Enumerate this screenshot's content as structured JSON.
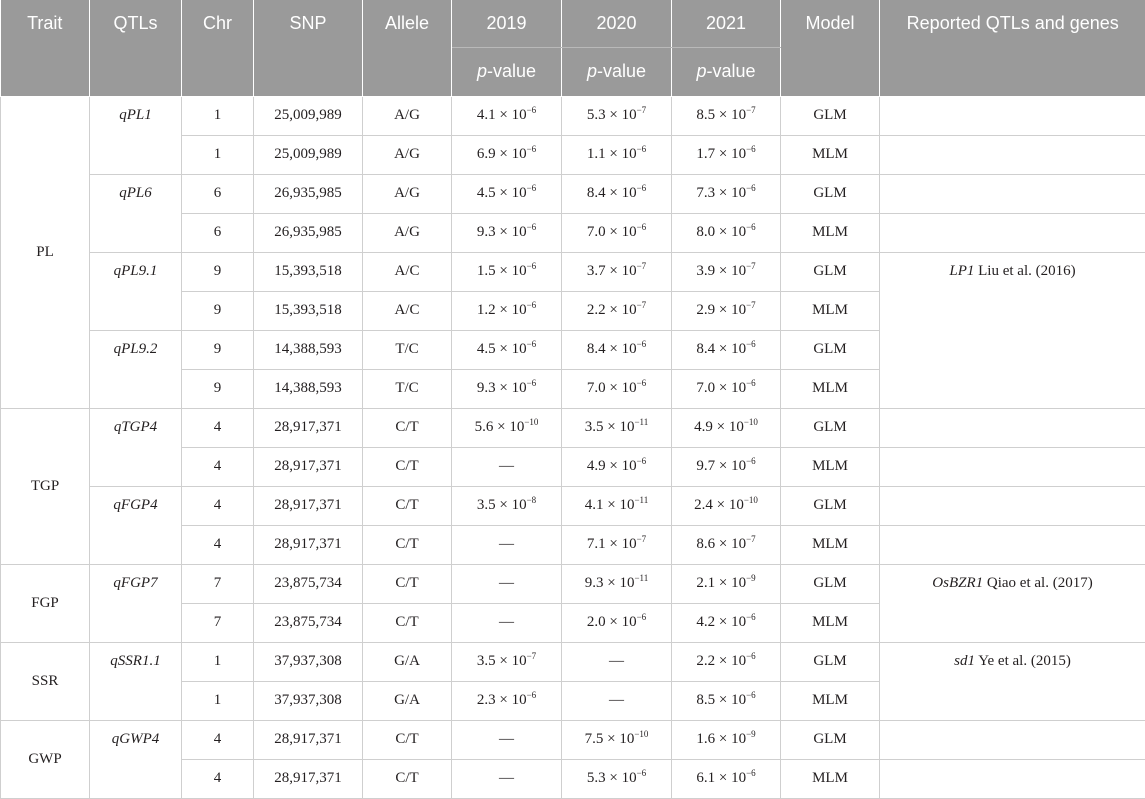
{
  "headers": {
    "trait": "Trait",
    "qtls": "QTLs",
    "chr": "Chr",
    "snp": "SNP",
    "allele": "Allele",
    "y2019": "2019",
    "y2020": "2020",
    "y2021": "2021",
    "model": "Model",
    "reported": "Reported QTLs and genes",
    "pvalue_italic": "p",
    "pvalue_rest": "-value"
  },
  "traits": {
    "pl": "PL",
    "tgp": "TGP",
    "fgp": "FGP",
    "ssr": "SSR",
    "gwp": "GWP"
  },
  "qtls": {
    "qpl1": "qPL1",
    "qpl6": "qPL6",
    "qpl91": "qPL9.1",
    "qpl92": "qPL9.2",
    "qtgp4": "qTGP4",
    "qfgp4": "qFGP4",
    "qfgp7": "qFGP7",
    "qssr11": "qSSR1.1",
    "qgwp4": "qGWP4"
  },
  "rows": [
    {
      "chr": "1",
      "snp": "25,009,989",
      "allele": "A/G",
      "p2019": {
        "m": "4.1",
        "e": "−6"
      },
      "p2020": {
        "m": "5.3",
        "e": "−7"
      },
      "p2021": {
        "m": "8.5",
        "e": "−7"
      },
      "model": "GLM"
    },
    {
      "chr": "1",
      "snp": "25,009,989",
      "allele": "A/G",
      "p2019": {
        "m": "6.9",
        "e": "−6"
      },
      "p2020": {
        "m": "1.1",
        "e": "−6"
      },
      "p2021": {
        "m": "1.7",
        "e": "−6"
      },
      "model": "MLM"
    },
    {
      "chr": "6",
      "snp": "26,935,985",
      "allele": "A/G",
      "p2019": {
        "m": "4.5",
        "e": "−6"
      },
      "p2020": {
        "m": "8.4",
        "e": "−6"
      },
      "p2021": {
        "m": "7.3",
        "e": "−6"
      },
      "model": "GLM"
    },
    {
      "chr": "6",
      "snp": "26,935,985",
      "allele": "A/G",
      "p2019": {
        "m": "9.3",
        "e": "−6"
      },
      "p2020": {
        "m": "7.0",
        "e": "−6"
      },
      "p2021": {
        "m": "8.0",
        "e": "−6"
      },
      "model": "MLM"
    },
    {
      "chr": "9",
      "snp": "15,393,518",
      "allele": "A/C",
      "p2019": {
        "m": "1.5",
        "e": "−6"
      },
      "p2020": {
        "m": "3.7",
        "e": "−7"
      },
      "p2021": {
        "m": "3.9",
        "e": "−7"
      },
      "model": "GLM"
    },
    {
      "chr": "9",
      "snp": "15,393,518",
      "allele": "A/C",
      "p2019": {
        "m": "1.2",
        "e": "−6"
      },
      "p2020": {
        "m": "2.2",
        "e": "−7"
      },
      "p2021": {
        "m": "2.9",
        "e": "−7"
      },
      "model": "MLM"
    },
    {
      "chr": "9",
      "snp": "14,388,593",
      "allele": "T/C",
      "p2019": {
        "m": "4.5",
        "e": "−6"
      },
      "p2020": {
        "m": "8.4",
        "e": "−6"
      },
      "p2021": {
        "m": "8.4",
        "e": "−6"
      },
      "model": "GLM"
    },
    {
      "chr": "9",
      "snp": "14,388,593",
      "allele": "T/C",
      "p2019": {
        "m": "9.3",
        "e": "−6"
      },
      "p2020": {
        "m": "7.0",
        "e": "−6"
      },
      "p2021": {
        "m": "7.0",
        "e": "−6"
      },
      "model": "MLM"
    },
    {
      "chr": "4",
      "snp": "28,917,371",
      "allele": "C/T",
      "p2019": {
        "m": "5.6",
        "e": "−10"
      },
      "p2020": {
        "m": "3.5",
        "e": "−11"
      },
      "p2021": {
        "m": "4.9",
        "e": "−10"
      },
      "model": "GLM"
    },
    {
      "chr": "4",
      "snp": "28,917,371",
      "allele": "C/T",
      "p2019": {
        "dash": "—"
      },
      "p2020": {
        "m": "4.9",
        "e": "−6"
      },
      "p2021": {
        "m": "9.7",
        "e": "−6"
      },
      "model": "MLM"
    },
    {
      "chr": "4",
      "snp": "28,917,371",
      "allele": "C/T",
      "p2019": {
        "m": "3.5",
        "e": "−8"
      },
      "p2020": {
        "m": "4.1",
        "e": "−11"
      },
      "p2021": {
        "m": "2.4",
        "e": "−10"
      },
      "model": "GLM"
    },
    {
      "chr": "4",
      "snp": "28,917,371",
      "allele": "C/T",
      "p2019": {
        "dash": "—"
      },
      "p2020": {
        "m": "7.1",
        "e": "−7"
      },
      "p2021": {
        "m": "8.6",
        "e": "−7"
      },
      "model": "MLM"
    },
    {
      "chr": "7",
      "snp": "23,875,734",
      "allele": "C/T",
      "p2019": {
        "dash": "—"
      },
      "p2020": {
        "m": "9.3",
        "e": "−11"
      },
      "p2021": {
        "m": "2.1",
        "e": "−9"
      },
      "model": "GLM"
    },
    {
      "chr": "7",
      "snp": "23,875,734",
      "allele": "C/T",
      "p2019": {
        "dash": "—"
      },
      "p2020": {
        "m": "2.0",
        "e": "−6"
      },
      "p2021": {
        "m": "4.2",
        "e": "−6"
      },
      "model": "MLM"
    },
    {
      "chr": "1",
      "snp": "37,937,308",
      "allele": "G/A",
      "p2019": {
        "m": "3.5",
        "e": "−7"
      },
      "p2020": {
        "dash": "—"
      },
      "p2021": {
        "m": "2.2",
        "e": "−6"
      },
      "model": "GLM"
    },
    {
      "chr": "1",
      "snp": "37,937,308",
      "allele": "G/A",
      "p2019": {
        "m": "2.3",
        "e": "−6"
      },
      "p2020": {
        "dash": "—"
      },
      "p2021": {
        "m": "8.5",
        "e": "−6"
      },
      "model": "MLM"
    },
    {
      "chr": "4",
      "snp": "28,917,371",
      "allele": "C/T",
      "p2019": {
        "dash": "—"
      },
      "p2020": {
        "m": "7.5",
        "e": "−10"
      },
      "p2021": {
        "m": "1.6",
        "e": "−9"
      },
      "model": "GLM"
    },
    {
      "chr": "4",
      "snp": "28,917,371",
      "allele": "C/T",
      "p2019": {
        "dash": "—"
      },
      "p2020": {
        "m": "5.3",
        "e": "−6"
      },
      "p2021": {
        "m": "6.1",
        "e": "−6"
      },
      "model": "MLM"
    }
  ],
  "reported": {
    "lp1_gene": "LP1",
    "lp1_ref": " Liu et al. (2016)",
    "osbzr1_gene": "OsBZR1",
    "osbzr1_ref": " Qiao et al. (2017)",
    "sd1_gene": "sd1",
    "sd1_ref": " Ye et al. (2015)"
  },
  "times_sign": "×",
  "base": "10"
}
